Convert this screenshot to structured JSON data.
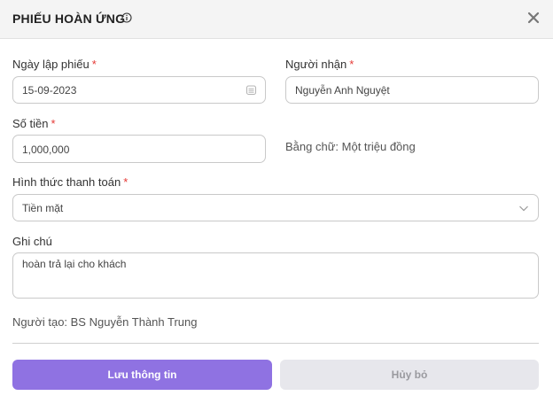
{
  "header": {
    "title": "PHIẾU HOÀN ỨNG",
    "close_label": "×"
  },
  "form": {
    "date": {
      "label": "Ngày lập phiếu",
      "required_mark": "*",
      "value": "15-09-2023"
    },
    "recipient": {
      "label": "Người nhận",
      "required_mark": "*",
      "value": "Nguyễn Anh Nguyệt"
    },
    "amount": {
      "label": "Số tiền",
      "required_mark": "*",
      "value": "1,000,000",
      "in_words": "Bằng chữ: Một triệu đồng"
    },
    "payment_method": {
      "label": "Hình thức thanh toán",
      "required_mark": "*",
      "value": "Tiền mặt"
    },
    "note": {
      "label": "Ghi chú",
      "value": "hoàn trả lại cho khách"
    },
    "creator": "Người tạo: BS Nguyễn Thành Trung"
  },
  "actions": {
    "save_label": "Lưu thông tin",
    "cancel_label": "Hủy bỏ"
  },
  "colors": {
    "primary": "#8f72e2",
    "required": "#e53935",
    "cancel_bg": "#e7e7ec"
  }
}
